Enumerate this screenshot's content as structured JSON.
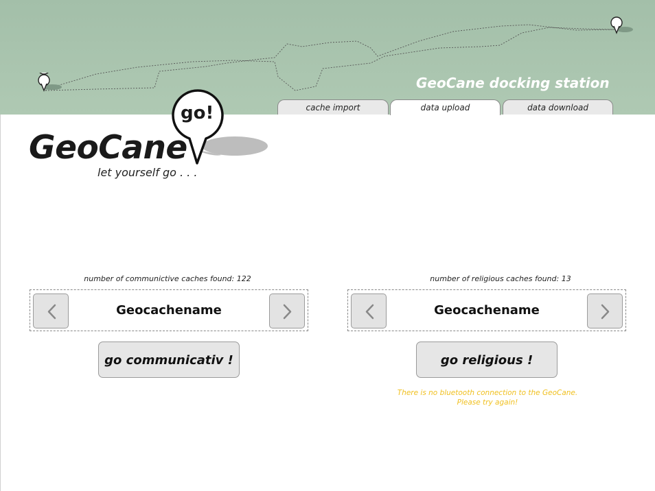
{
  "header": {
    "title": "GeoCane docking station",
    "tabs": [
      {
        "label": "cache import",
        "active": false
      },
      {
        "label": "data upload",
        "active": true
      },
      {
        "label": "data download",
        "active": false
      }
    ],
    "background_color": "#a9c4ae"
  },
  "logo": {
    "name": "GeoCane",
    "bubble_text": "go!",
    "tagline": "let yourself go . . ."
  },
  "communicative": {
    "count_label": "number of communictive caches found: 122",
    "cache_name": "Geocachename",
    "action_label": "go communicativ !"
  },
  "religious": {
    "count_label": "number of religious caches found: 13",
    "cache_name": "Geocachename",
    "action_label": "go religious !"
  },
  "status": {
    "error_line1": "There is no bluetooth connection to the GeoCane.",
    "error_line2": "Please try again!",
    "error_color": "#f0c020"
  },
  "icons": {
    "prev": "chevron-left-icon",
    "next": "chevron-right-icon",
    "pin": "map-pin-icon"
  }
}
